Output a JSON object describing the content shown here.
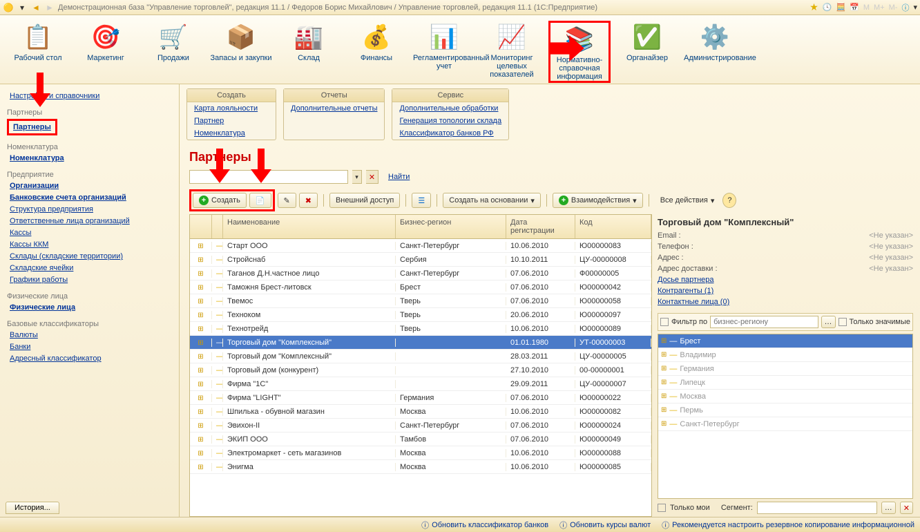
{
  "titlebar": {
    "title": "Демонстрационная база \"Управление торговлей\", редакция 11.1 / Федоров Борис Михайлович / Управление торговлей, редакция 11.1  (1С:Предприятие)",
    "m1": "M",
    "m2": "M+",
    "m3": "M-"
  },
  "toolbar": [
    {
      "label": "Рабочий стол"
    },
    {
      "label": "Маркетинг"
    },
    {
      "label": "Продажи"
    },
    {
      "label": "Запасы и закупки"
    },
    {
      "label": "Склад"
    },
    {
      "label": "Финансы"
    },
    {
      "label": "Регламентированный учет"
    },
    {
      "label": "Мониторинг целевых показателей"
    },
    {
      "label": "Нормативно-справочная информация"
    },
    {
      "label": "Органайзер"
    },
    {
      "label": "Администрирование"
    }
  ],
  "sidebar": {
    "top": "Настройки и справочники",
    "g_partners": "Партнеры",
    "partners": "Партнеры",
    "g_nom": "Номенклатура",
    "nom": "Номенклатура",
    "g_ent": "Предприятие",
    "ent": [
      "Организации",
      "Банковские счета организаций",
      "Структура предприятия",
      "Ответственные лица организаций",
      "Кассы",
      "Кассы ККМ",
      "Склады (складские территории)",
      "Складские ячейки",
      "Графики работы"
    ],
    "g_fiz": "Физические лица",
    "fiz": "Физические лица",
    "g_base": "Базовые классификаторы",
    "base": [
      "Валюты",
      "Банки",
      "Адресный классификатор"
    ]
  },
  "submenus": {
    "create": {
      "h": "Создать",
      "items": [
        "Карта лояльности",
        "Партнер",
        "Номенклатура"
      ]
    },
    "reports": {
      "h": "Отчеты",
      "items": [
        "Дополнительные отчеты"
      ]
    },
    "service": {
      "h": "Сервис",
      "items": [
        "Дополнительные обработки",
        "Генерация топологии склада",
        "Классификатор банков РФ"
      ]
    }
  },
  "page": {
    "title": "Партнеры",
    "find": "Найти"
  },
  "actions": {
    "create": "Создать",
    "ext": "Внешний доступ",
    "cob": "Создать на основании",
    "inter": "Взаимодействия",
    "all": "Все действия"
  },
  "grid": {
    "cols": [
      "Наименование",
      "Бизнес-регион",
      "Дата регистрации",
      "Код"
    ],
    "rows": [
      {
        "n": "Старт ООО",
        "r": "Санкт-Петербург",
        "d": "10.06.2010",
        "c": "Ю00000083"
      },
      {
        "n": "Стройснаб",
        "r": "Сербия",
        "d": "10.10.2011",
        "c": "ЦУ-00000008"
      },
      {
        "n": "Таганов Д.Н.частное лицо",
        "r": "Санкт-Петербург",
        "d": "07.06.2010",
        "c": "Ф00000005"
      },
      {
        "n": "Таможня Брест-литовск",
        "r": "Брест",
        "d": "07.06.2010",
        "c": "Ю00000042"
      },
      {
        "n": "Твемос",
        "r": "Тверь",
        "d": "07.06.2010",
        "c": "Ю00000058"
      },
      {
        "n": "Техноком",
        "r": "Тверь",
        "d": "20.06.2010",
        "c": "Ю00000097"
      },
      {
        "n": "Технотрейд",
        "r": "Тверь",
        "d": "10.06.2010",
        "c": "Ю00000089"
      },
      {
        "n": "Торговый дом \"Комплексный\"",
        "r": "",
        "d": "01.01.1980",
        "c": "УТ-00000003",
        "sel": true
      },
      {
        "n": "Торговый дом \"Комплексный\"",
        "r": "",
        "d": "28.03.2011",
        "c": "ЦУ-00000005"
      },
      {
        "n": "Торговый дом (конкурент)",
        "r": "",
        "d": "27.10.2010",
        "c": "00-00000001"
      },
      {
        "n": "Фирма \"1С\"",
        "r": "",
        "d": "29.09.2011",
        "c": "ЦУ-00000007"
      },
      {
        "n": "Фирма \"LIGHT\"",
        "r": "Германия",
        "d": "07.06.2010",
        "c": "Ю00000022"
      },
      {
        "n": "Шпилька - обувной магазин",
        "r": "Москва",
        "d": "10.06.2010",
        "c": "Ю00000082"
      },
      {
        "n": "Эвихон-II",
        "r": "Санкт-Петербург",
        "d": "07.06.2010",
        "c": "Ю00000024"
      },
      {
        "n": "ЭКИП ООО",
        "r": "Тамбов",
        "d": "07.06.2010",
        "c": "Ю00000049"
      },
      {
        "n": "Электромаркет - сеть магазинов",
        "r": "Москва",
        "d": "10.06.2010",
        "c": "Ю00000088"
      },
      {
        "n": "Энигма",
        "r": "Москва",
        "d": "10.06.2010",
        "c": "Ю00000085"
      }
    ]
  },
  "details": {
    "title": "Торговый дом \"Комплексный\"",
    "email_l": "Email :",
    "email_v": "<Не указан>",
    "tel_l": "Телефон :",
    "tel_v": "<Не указан>",
    "addr_l": "Адрес :",
    "addr_v": "<Не указан>",
    "daddr_l": "Адрес доставки :",
    "daddr_v": "<Не указан>",
    "dossier": "Досье партнера",
    "kontr": "Контрагенты (1)",
    "kont": "Контактные лица (0)",
    "filter_l": "Фильтр по",
    "filter_ph": "бизнес-региону",
    "only_sig": "Только значимые",
    "regions": [
      "Брест",
      "Владимир",
      "Германия",
      "Липецк",
      "Москва",
      "Пермь",
      "Санкт-Петербург"
    ],
    "only_my": "Только мои",
    "segment": "Сегмент:"
  },
  "status": {
    "history": "История...",
    "s1": "Обновить классификатор банков",
    "s2": "Обновить курсы валют",
    "s3": "Рекомендуется настроить резервное копирование информационной"
  }
}
